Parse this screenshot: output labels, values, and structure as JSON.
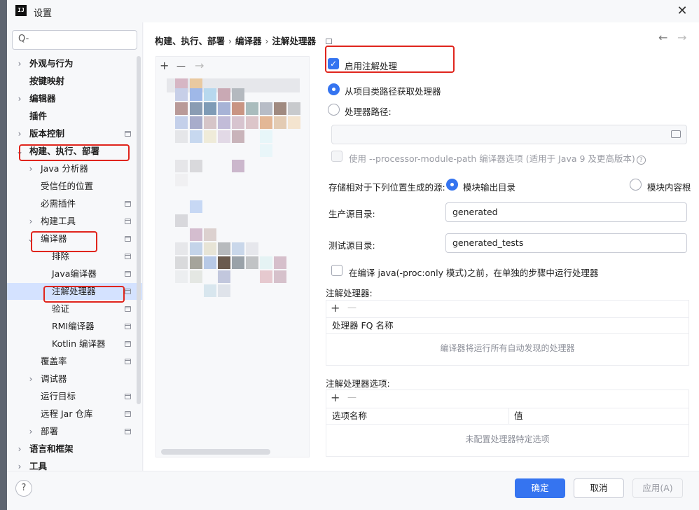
{
  "window": {
    "title": "设置",
    "app_icon_text": "IJ"
  },
  "search": {
    "placeholder": "Q-"
  },
  "sidebar": {
    "items": [
      {
        "label": "外观与行为",
        "bold": true
      },
      {
        "label": "按键映射",
        "bold": true
      },
      {
        "label": "编辑器",
        "bold": true
      },
      {
        "label": "插件",
        "bold": true
      },
      {
        "label": "版本控制",
        "bold": true
      },
      {
        "label": "构建、执行、部署",
        "bold": true
      },
      {
        "label": "Java 分析器"
      },
      {
        "label": "受信任的位置"
      },
      {
        "label": "必需插件"
      },
      {
        "label": "构建工具"
      },
      {
        "label": "编译器"
      },
      {
        "label": "排除"
      },
      {
        "label": "Java编译器"
      },
      {
        "label": "注解处理器"
      },
      {
        "label": "验证"
      },
      {
        "label": "RMI编译器"
      },
      {
        "label": "Kotlin 编译器"
      },
      {
        "label": "覆盖率"
      },
      {
        "label": "调试器"
      },
      {
        "label": "运行目标"
      },
      {
        "label": "远程 Jar 仓库"
      },
      {
        "label": "部署"
      },
      {
        "label": "语言和框架",
        "bold": true
      },
      {
        "label": "工具",
        "bold": true
      }
    ]
  },
  "breadcrumb": {
    "part1": "构建、执行、部署",
    "part2": "编译器",
    "part3": "注解处理器",
    "sep": "›"
  },
  "profiles": {
    "add": "+",
    "remove": "—",
    "move": "→"
  },
  "settings": {
    "enable_annotation_processing": "启用注解处理",
    "obtain_from_classpath": "从项目类路径获取处理器",
    "processor_path": "处理器路径:",
    "processor_path_value": "",
    "use_module_path": "使用 --processor-module-path 编译器选项 (适用于 Java 9 及更高版本)",
    "store_generated_sources": "存储相对于下列位置生成的源:",
    "module_output_dir": "模块输出目录",
    "module_content_root": "模块内容根",
    "production_sources_dir_label": "生产源目录:",
    "production_sources_dir_value": "generated",
    "test_sources_dir_label": "测试源目录:",
    "test_sources_dir_value": "generated_tests",
    "run_separately": "在编译 java(-proc:only 模式)之前，在单独的步骤中运行处理器"
  },
  "processors_table": {
    "title": "注解处理器:",
    "column": "处理器 FQ 名称",
    "empty_text": "编译器将运行所有自动发现的处理器"
  },
  "options_table": {
    "title": "注解处理器选项:",
    "col_name": "选项名称",
    "col_value": "值",
    "empty_text": "未配置处理器特定选项"
  },
  "footer": {
    "help": "?",
    "ok": "确定",
    "cancel": "取消",
    "apply": "应用(A)"
  },
  "colors": {
    "accent": "#3574f0",
    "annotation_red": "#e0251d",
    "selection": "#d4e2ff"
  }
}
